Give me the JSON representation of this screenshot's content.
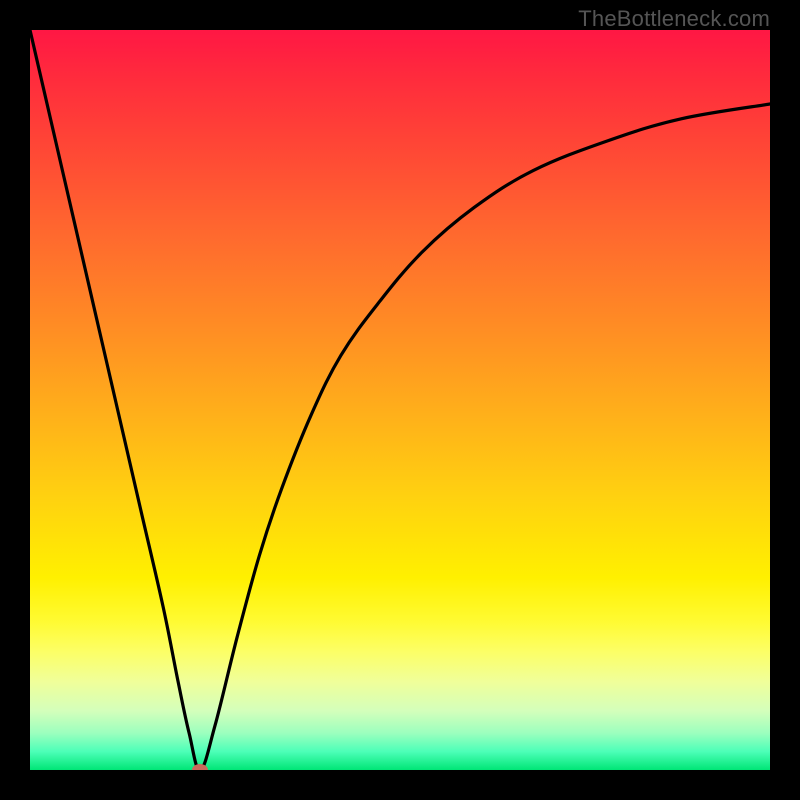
{
  "watermark": "TheBottleneck.com",
  "chart_data": {
    "type": "line",
    "title": "",
    "xlabel": "",
    "ylabel": "",
    "xlim": [
      0,
      100
    ],
    "ylim": [
      0,
      100
    ],
    "background_gradient": {
      "top_color": "#ff1744",
      "bottom_color": "#00e676",
      "stops": [
        {
          "pos": 0,
          "color": "#ff1744"
        },
        {
          "pos": 40,
          "color": "#ff8c24"
        },
        {
          "pos": 74,
          "color": "#fff000"
        },
        {
          "pos": 100,
          "color": "#00e676"
        }
      ]
    },
    "series": [
      {
        "name": "bottleneck-curve",
        "x": [
          0,
          3,
          6,
          9,
          12,
          15,
          18,
          20,
          21.5,
          23,
          25,
          28,
          31,
          34,
          38,
          42,
          47,
          53,
          60,
          68,
          78,
          88,
          100
        ],
        "values": [
          100,
          87,
          74,
          61,
          48,
          35,
          22,
          12,
          5,
          0,
          6,
          18,
          29,
          38,
          48,
          56,
          63,
          70,
          76,
          81,
          85,
          88,
          90
        ]
      }
    ],
    "marker": {
      "name": "optimum-point",
      "x": 23,
      "y": 0,
      "color": "#c96a5b"
    }
  }
}
